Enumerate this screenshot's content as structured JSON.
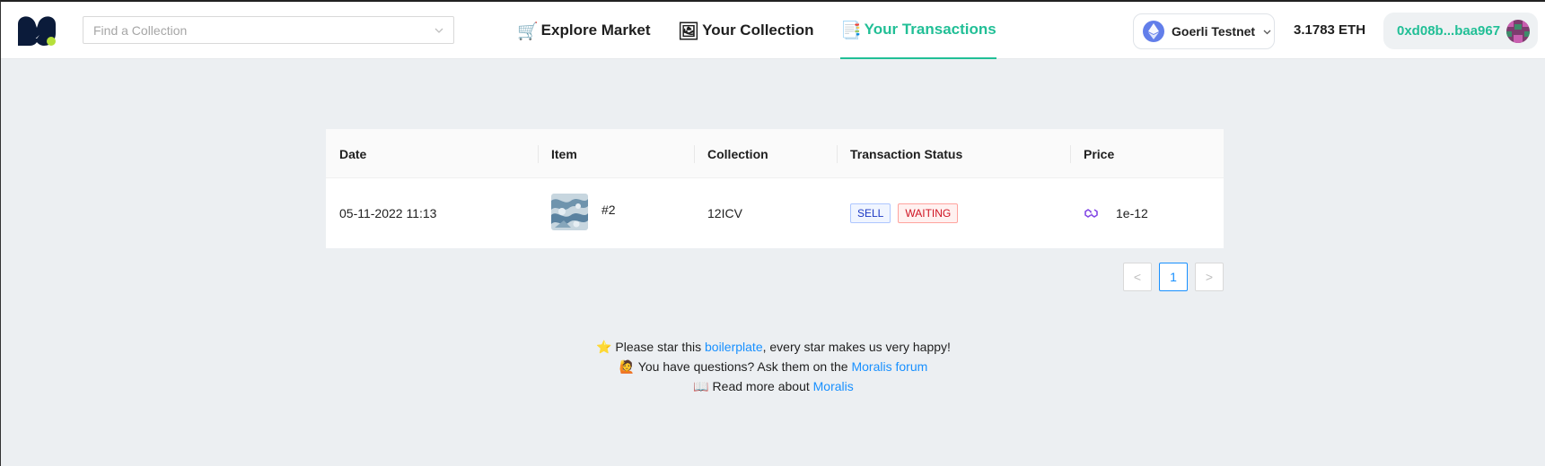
{
  "header": {
    "search": {
      "placeholder": "Find a Collection"
    },
    "nav": [
      {
        "emoji": "🛒",
        "label": "Explore Market"
      },
      {
        "emoji": "🖼",
        "label": "Your Collection"
      },
      {
        "emoji": "📑",
        "label": "Your Transactions",
        "active": true
      }
    ],
    "network": {
      "label": "Goerli Testnet",
      "icon": "ethereum-icon"
    },
    "balance": "3.1783 ETH",
    "wallet": {
      "address": "0xd08b...baa967"
    },
    "colors": {
      "accent": "#21bf96",
      "ethereum": "#627eea"
    }
  },
  "table": {
    "columns": [
      "Date",
      "Item",
      "Collection",
      "Transaction Status",
      "Price"
    ],
    "rows": [
      {
        "date": "05-11-2022 11:13",
        "item": "#2",
        "collection": "12ICV",
        "tags": [
          "SELL",
          "WAITING"
        ],
        "price": "1e-12"
      }
    ]
  },
  "pagination": {
    "prev": "<",
    "current": "1",
    "next": ">"
  },
  "footer": {
    "line1": {
      "emoji": "⭐",
      "before": " Please star this ",
      "link": "boilerplate",
      "after": ", every star makes us very happy!"
    },
    "line2": {
      "emoji": "🙋",
      "before": " You have questions? Ask them on the ",
      "link": "Moralis forum",
      "after": ""
    },
    "line3": {
      "emoji": "📖",
      "before": " Read more about ",
      "link": "Moralis",
      "after": ""
    }
  }
}
